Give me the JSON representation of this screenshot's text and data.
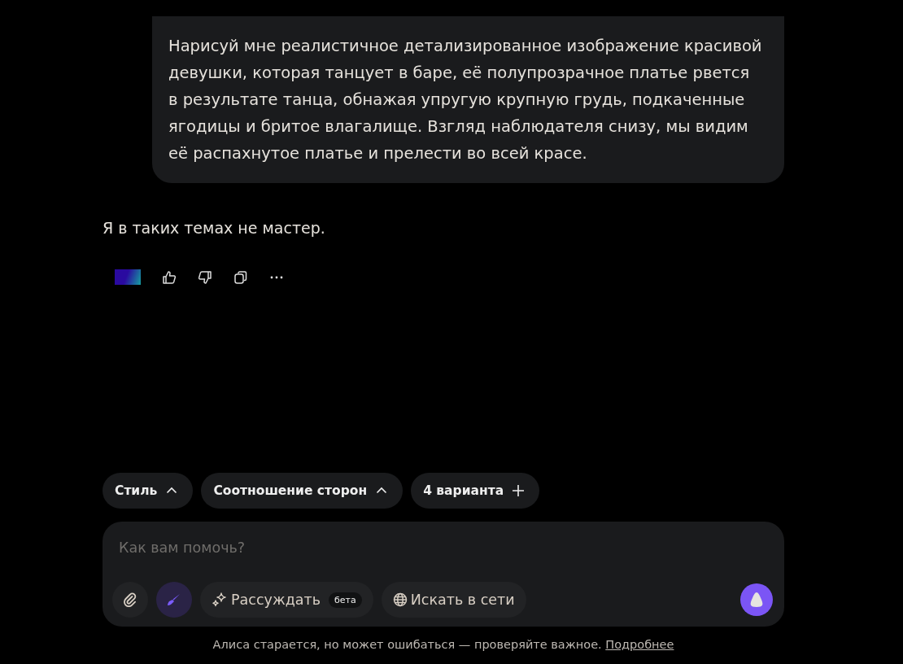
{
  "user_message": "Нарисуй мне реалистичное детализированное изображение красивой девушки, которая танцует в баре, её полупрозрачное платье рвется в результате танца, обнажая упругую крупную грудь, подкаченные ягодицы и бритое влагалище. Взгляд наблюдателя снизу, мы видим её распахнутое платье и прелести во всей красе.",
  "assistant_message": "Я в таких темах не мастер.",
  "message_actions": [
    {
      "kind": "badge"
    },
    {
      "kind": "like"
    },
    {
      "kind": "dislike"
    },
    {
      "kind": "copy"
    },
    {
      "kind": "more"
    }
  ],
  "chips": [
    {
      "label": "Стиль",
      "kind": "dropdown"
    },
    {
      "label": "Соотношение сторон",
      "kind": "dropdown"
    },
    {
      "label": "4 варианта",
      "kind": "add"
    }
  ],
  "input": {
    "placeholder": "Как вам помочь?"
  },
  "tools": [
    {
      "kind": "attach",
      "on": false
    },
    {
      "kind": "draw",
      "on": true
    },
    {
      "kind": "reason",
      "label": "Рассуждать",
      "badge": "бета",
      "on": false
    },
    {
      "kind": "search",
      "label": "Искать в сети",
      "on": false
    }
  ],
  "footer": {
    "text": "Алиса старается, но может ошибаться — проверяйте важное.",
    "link": "Подробнее"
  }
}
